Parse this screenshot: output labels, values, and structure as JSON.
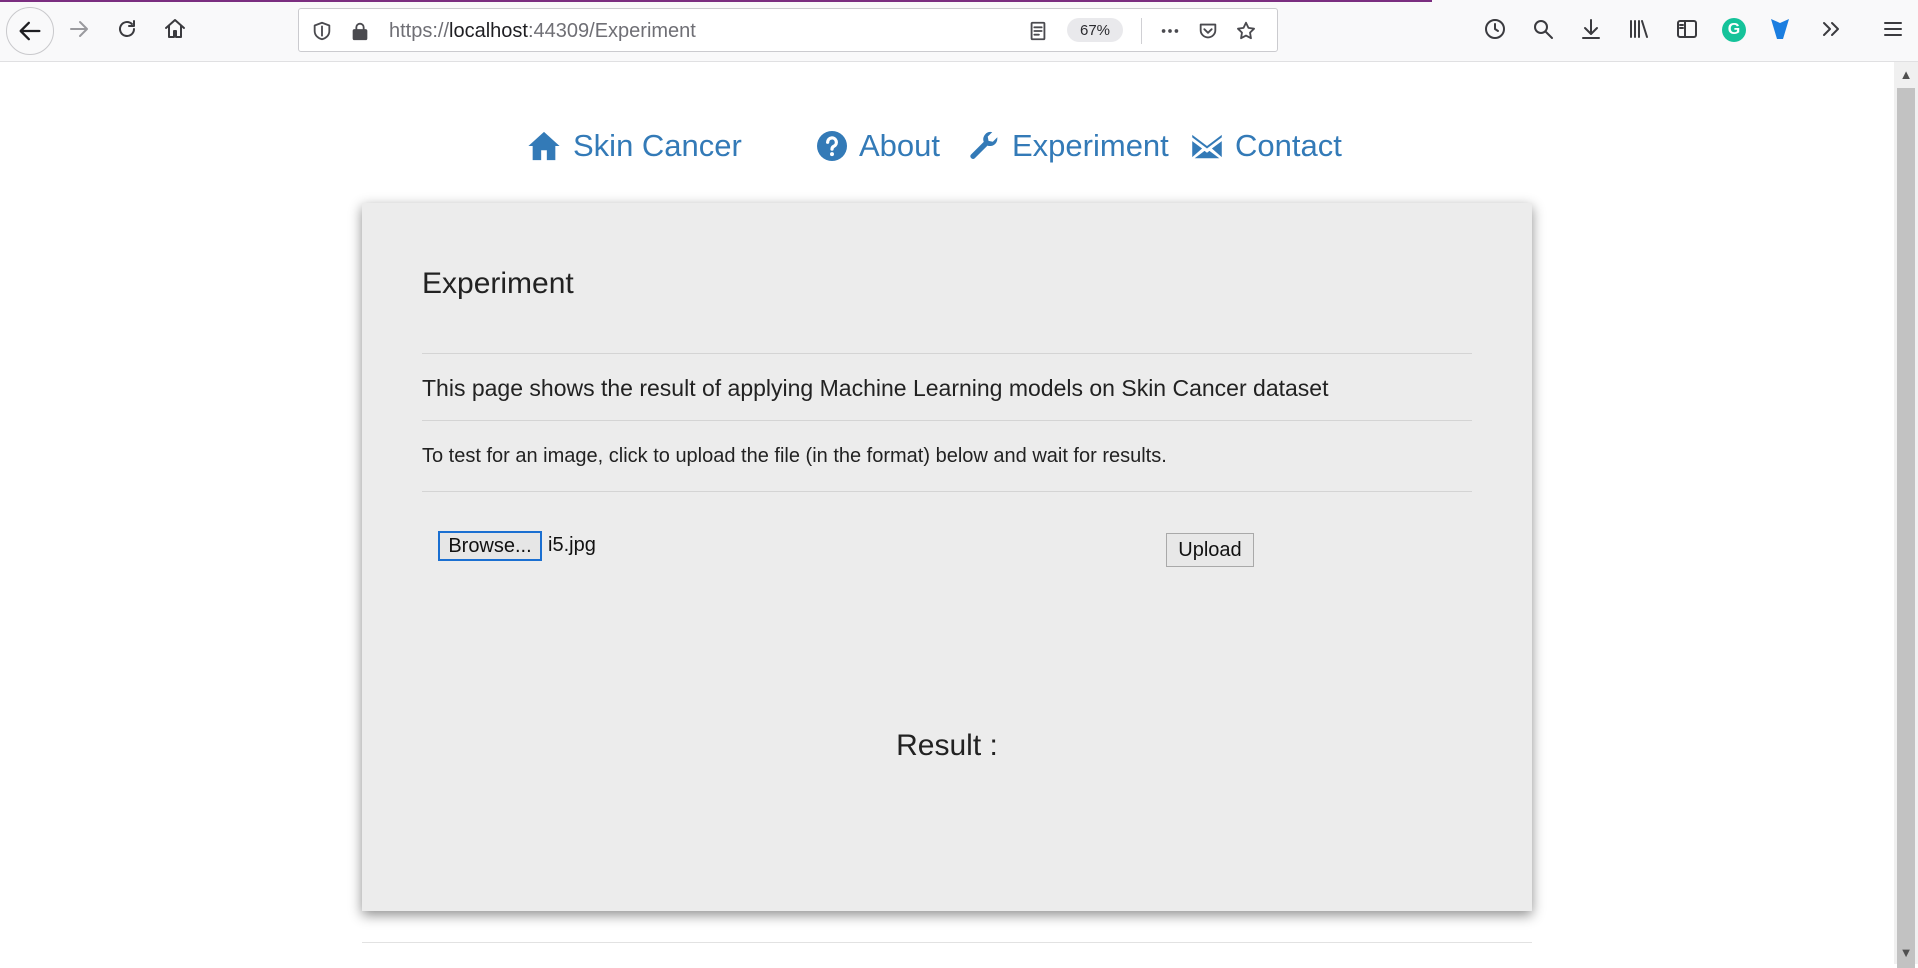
{
  "browser": {
    "url_prefix": "https://",
    "url_host": "localhost",
    "url_rest": ":44309/Experiment",
    "zoom": "67%"
  },
  "nav": {
    "brand": "Skin Cancer",
    "about": "About",
    "experiment": "Experiment",
    "contact": "Contact"
  },
  "content": {
    "heading": "Experiment",
    "intro": "This page shows the result of applying Machine Learning models on Skin Cancer dataset",
    "instructions": "To test for an image, click to upload the file (in the format) below and wait for results.",
    "browse_label": "Browse...",
    "file_name": "i5.jpg",
    "upload_label": "Upload",
    "result_label": "Result :"
  },
  "colors": {
    "link": "#337ab7",
    "card_bg": "#ececec",
    "accent": "#7b2e80"
  },
  "icons": [
    "back-icon",
    "forward-icon",
    "reload-icon",
    "home-icon",
    "tracking-shield-icon",
    "lock-icon",
    "reader-view-icon",
    "more-icon",
    "pocket-icon",
    "star-icon",
    "history-icon",
    "search-icon",
    "download-icon",
    "library-icon",
    "sidebar-icon",
    "grammarly-icon",
    "vpn-icon",
    "overflow-icon",
    "menu-icon",
    "question-icon",
    "wrench-icon",
    "envelope-icon"
  ]
}
